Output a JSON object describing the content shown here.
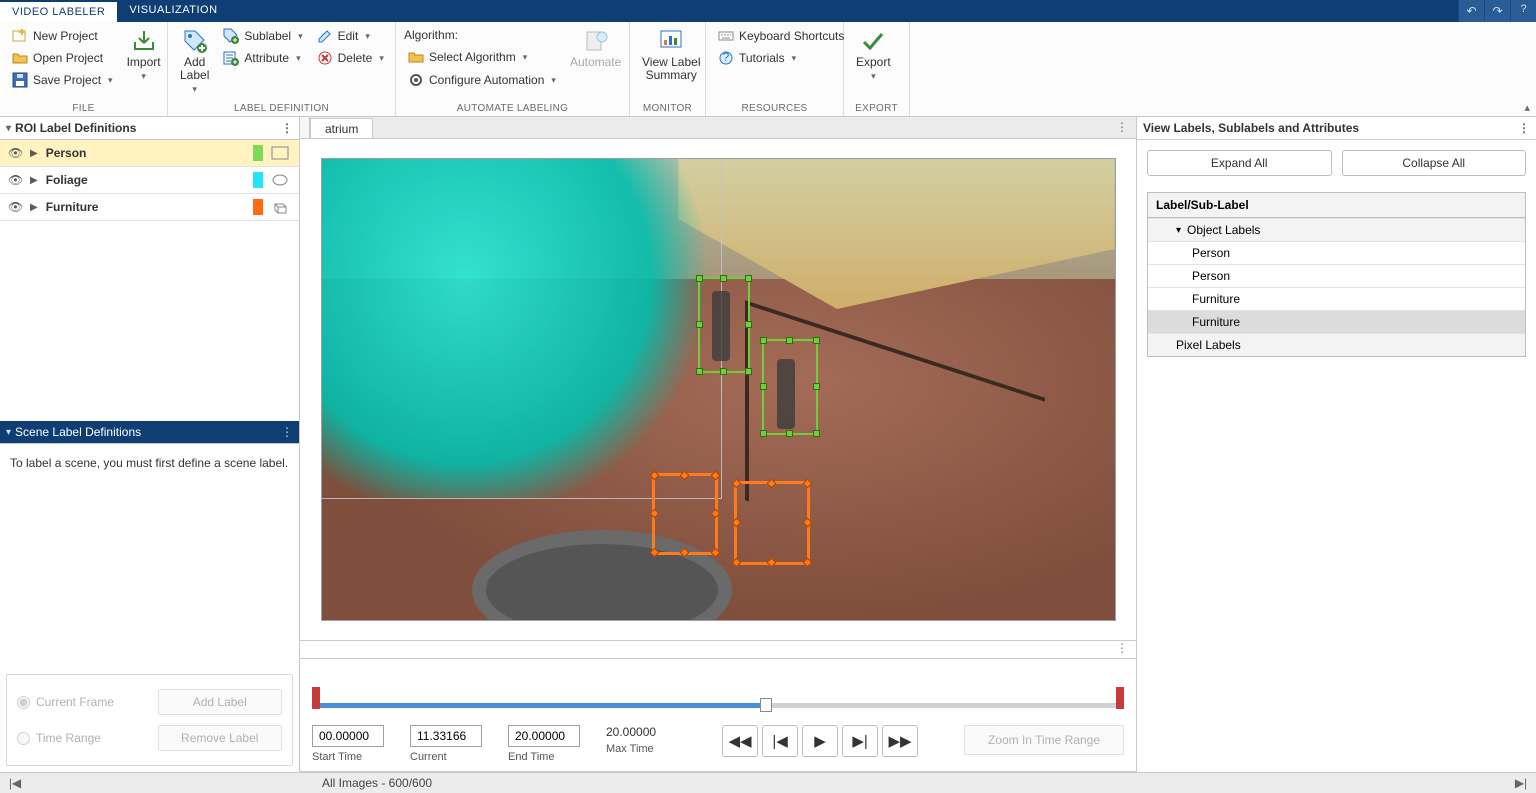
{
  "tabs": {
    "active": "VIDEO LABELER",
    "other": "VISUALIZATION"
  },
  "ribbon": {
    "file": {
      "new": "New Project",
      "open": "Open Project",
      "save": "Save Project",
      "import": "Import",
      "caption": "FILE"
    },
    "labeldef": {
      "add": "Add\nLabel",
      "sublabel": "Sublabel",
      "attribute": "Attribute",
      "edit": "Edit",
      "delete": "Delete",
      "caption": "LABEL DEFINITION"
    },
    "automate": {
      "algo_label": "Algorithm:",
      "select": "Select Algorithm",
      "config": "Configure Automation",
      "automate": "Automate",
      "caption": "AUTOMATE LABELING"
    },
    "monitor": {
      "view": "View Label\nSummary",
      "caption": "MONITOR"
    },
    "resources": {
      "kb": "Keyboard Shortcuts",
      "tut": "Tutorials",
      "caption": "RESOURCES"
    },
    "export": {
      "export": "Export",
      "caption": "EXPORT"
    }
  },
  "left": {
    "roi_header": "ROI Label Definitions",
    "labels": [
      {
        "name": "Person",
        "color": "#7ed957",
        "shape": "rect",
        "selected": true
      },
      {
        "name": "Foliage",
        "color": "#24e3ff",
        "shape": "brush",
        "selected": false
      },
      {
        "name": "Furniture",
        "color": "#ff6a13",
        "shape": "cube",
        "selected": false
      }
    ],
    "scene_header": "Scene Label Definitions",
    "scene_hint": "To label a scene, you must first define a scene label.",
    "cf": "Current Frame",
    "tr": "Time Range",
    "add": "Add Label",
    "remove": "Remove Label"
  },
  "doc_tab": "atrium",
  "timeline": {
    "start": "00.00000",
    "current": "11.33166",
    "end": "20.00000",
    "max": "20.00000",
    "start_cap": "Start Time",
    "current_cap": "Current",
    "end_cap": "End Time",
    "max_cap": "Max Time",
    "zoom": "Zoom In Time Range"
  },
  "right": {
    "header": "View Labels, Sublabels and Attributes",
    "expand": "Expand All",
    "collapse": "Collapse All",
    "col": "Label/Sub-Label",
    "tree": {
      "group1": "Object Labels",
      "items": [
        "Person",
        "Person",
        "Furniture",
        "Furniture"
      ],
      "selected_index": 3,
      "group2": "Pixel Labels"
    }
  },
  "status": "All Images - 600/600"
}
